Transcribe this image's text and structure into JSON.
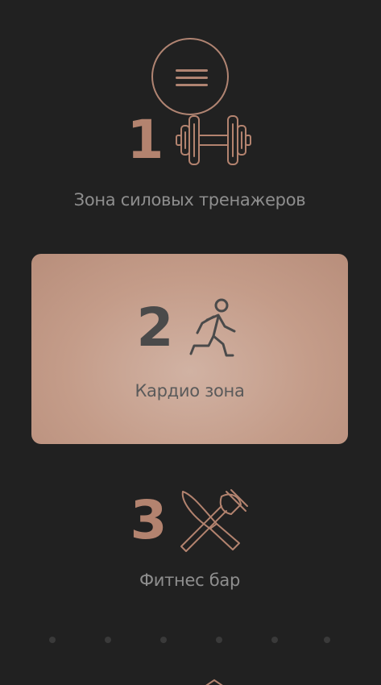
{
  "menu": {
    "icon": "hamburger-icon"
  },
  "zones": [
    {
      "number": "1",
      "label": "Зона силовых тренажеров",
      "icon": "dumbbell-icon",
      "active": false
    },
    {
      "number": "2",
      "label": "Кардио зона",
      "icon": "running-person-icon",
      "active": true
    },
    {
      "number": "3",
      "label": "Фитнес бар",
      "icon": "knife-fork-icon",
      "active": false
    }
  ],
  "pagination": {
    "count": 6,
    "icon": "dot-icon"
  },
  "scroll": {
    "icon": "chevron-up-icon"
  },
  "colors": {
    "background": "#212121",
    "accent": "#b3836f",
    "label": "#8e8e8e",
    "active_card": "#c49c89",
    "active_text": "#4a4a4a"
  }
}
